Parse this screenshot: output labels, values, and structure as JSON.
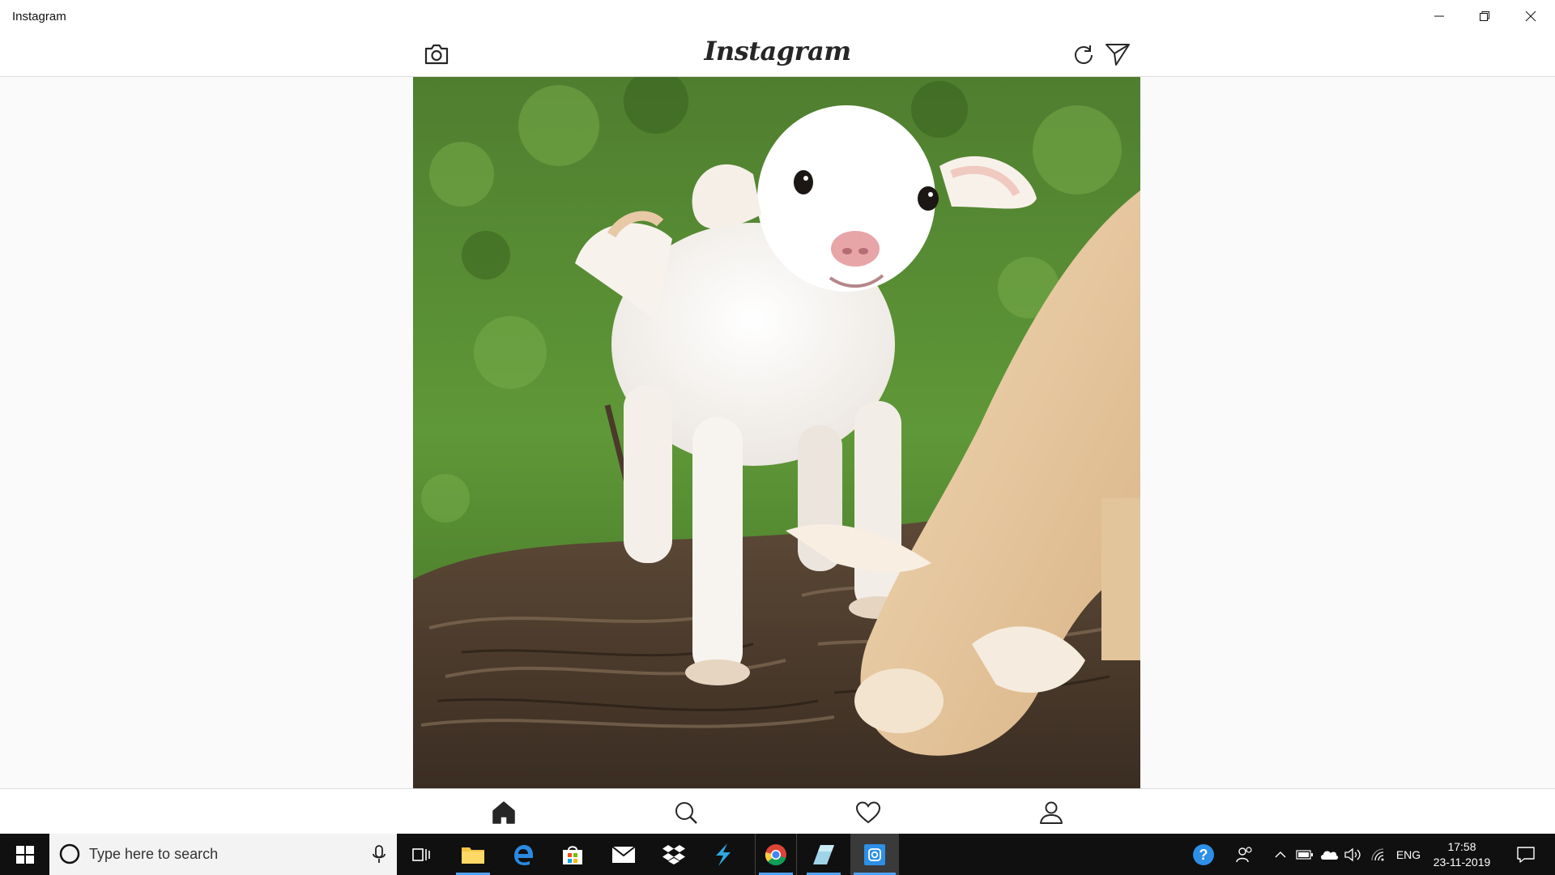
{
  "window": {
    "title": "Instagram"
  },
  "appbar": {
    "logo": "Instagram"
  },
  "taskbar": {
    "search_placeholder": "Type here to search",
    "language": "ENG",
    "time": "17:58",
    "date": "23-11-2019"
  },
  "colors": {
    "taskbar": "#101010",
    "active_indicator": "#4fa3f7",
    "nav_icon": "#262626"
  }
}
